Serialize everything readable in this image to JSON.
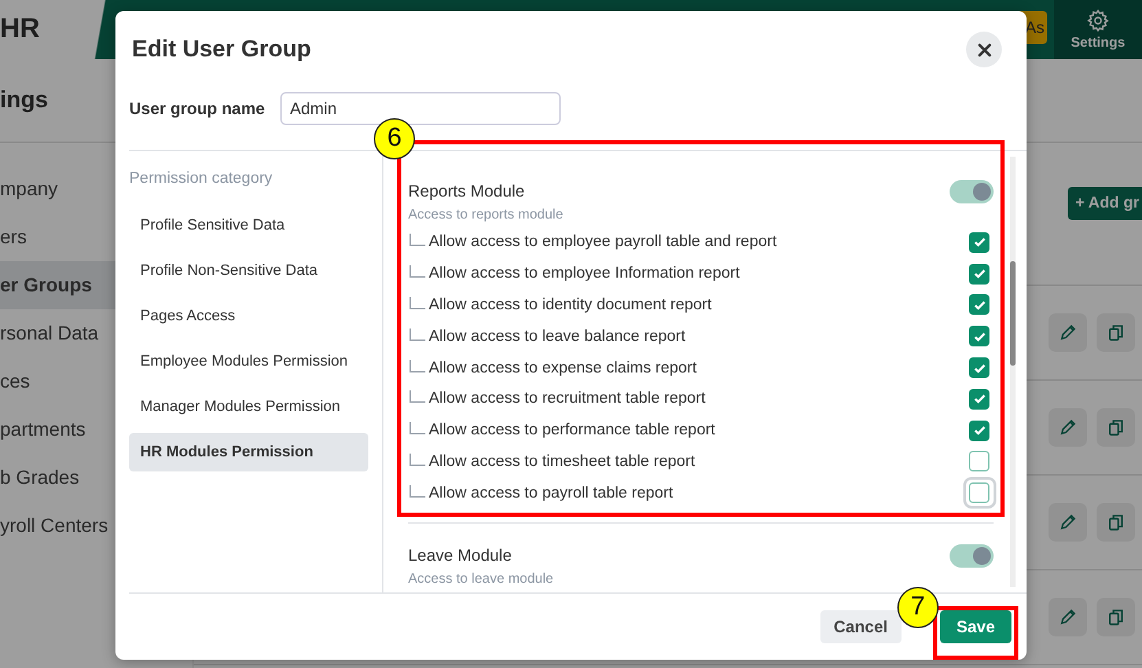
{
  "topbar": {
    "logo": "HR",
    "action_button": "As",
    "settings_label": "Settings"
  },
  "page": {
    "title": "ings",
    "add_button": "+ Add gr"
  },
  "sidebar": {
    "items": [
      {
        "label": "mpany",
        "selected": false
      },
      {
        "label": "ers",
        "selected": false
      },
      {
        "label": "er Groups",
        "selected": true
      },
      {
        "label": "rsonal Data",
        "selected": false
      },
      {
        "label": "ces",
        "selected": false
      },
      {
        "label": "partments",
        "selected": false
      },
      {
        "label": "b Grades",
        "selected": false
      },
      {
        "label": "yroll Centers",
        "selected": false
      }
    ]
  },
  "group_rows": [
    {
      "kind": "editable"
    },
    {
      "kind": "editable"
    },
    {
      "kind": "editable"
    },
    {
      "kind": "editable"
    }
  ],
  "dialog": {
    "title": "Edit User Group",
    "name_label": "User group name",
    "name_value": "Admin",
    "category_heading": "Permission category",
    "categories": [
      {
        "label": "Profile Sensitive Data",
        "selected": false
      },
      {
        "label": "Profile Non-Sensitive Data",
        "selected": false
      },
      {
        "label": "Pages Access",
        "selected": false
      },
      {
        "label": "Employee Modules Permission",
        "selected": false
      },
      {
        "label": "Manager Modules Permission",
        "selected": false
      },
      {
        "label": "HR Modules Permission",
        "selected": true
      }
    ],
    "modules": [
      {
        "title": "Reports Module",
        "description": "Access to reports module",
        "on": true,
        "permissions": [
          {
            "label": "Allow access to employee payroll table and report",
            "checked": true,
            "focused": false
          },
          {
            "label": "Allow access to employee Information report",
            "checked": true,
            "focused": false
          },
          {
            "label": "Allow access to identity document report",
            "checked": true,
            "focused": false
          },
          {
            "label": "Allow access to leave balance report",
            "checked": true,
            "focused": false
          },
          {
            "label": "Allow access to expense claims report",
            "checked": true,
            "focused": false
          },
          {
            "label": "Allow access to recruitment table report",
            "checked": true,
            "focused": false
          },
          {
            "label": "Allow access to performance table report",
            "checked": true,
            "focused": false
          },
          {
            "label": "Allow access to timesheet table report",
            "checked": false,
            "focused": false
          },
          {
            "label": "Allow access to payroll table report",
            "checked": false,
            "focused": true
          }
        ]
      },
      {
        "title": "Leave Module",
        "description": "Access to leave module",
        "on": true
      }
    ],
    "buttons": [
      {
        "label": "Cancel",
        "kind": "secondary"
      },
      {
        "label": "Save",
        "kind": "primary"
      }
    ]
  },
  "annotations": [
    {
      "number": "6",
      "kind": "module"
    },
    {
      "number": "7",
      "kind": "primary"
    }
  ]
}
